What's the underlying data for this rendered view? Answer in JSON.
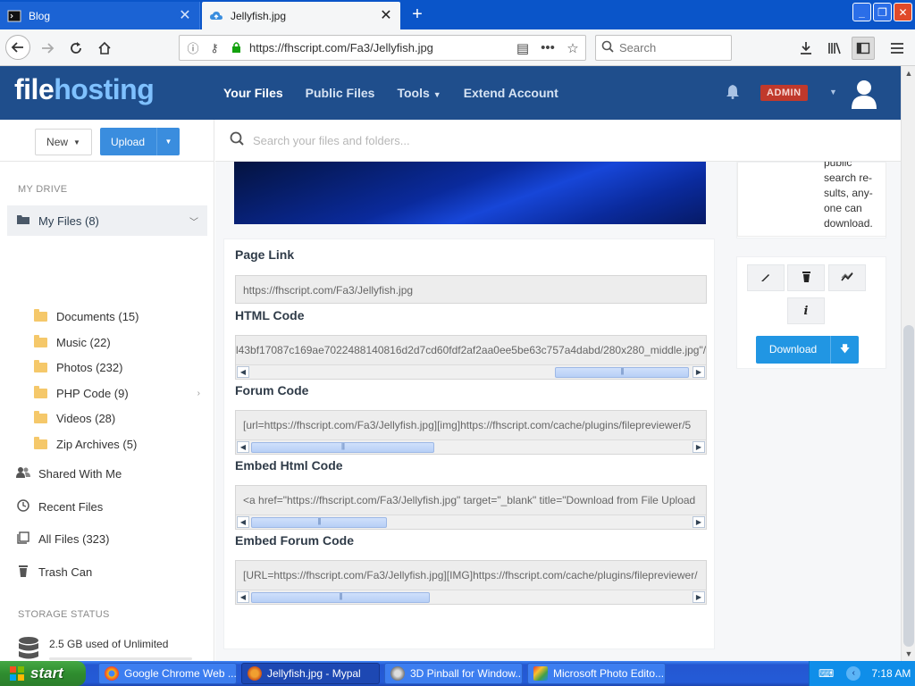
{
  "browser": {
    "tabs": [
      {
        "title": "Blog",
        "active": false,
        "icon": "terminal-icon"
      },
      {
        "title": "Jellyfish.jpg",
        "active": true,
        "icon": "cloud-upload-icon"
      }
    ],
    "url": "https://fhscript.com/Fa3/Jellyfish.jpg",
    "search_placeholder": "Search",
    "accent_color": "#0a55c9"
  },
  "site": {
    "logo_part1": "file",
    "logo_part2": "hosting",
    "nav": [
      {
        "label": "Your Files",
        "active": true
      },
      {
        "label": "Public Files",
        "active": false
      },
      {
        "label": "Tools",
        "active": false,
        "dropdown": true
      },
      {
        "label": "Extend Account",
        "active": false
      }
    ],
    "admin_badge": "ADMIN",
    "header_color": "#1f4e8c"
  },
  "toolbar": {
    "new_label": "New",
    "upload_label": "Upload",
    "files_search_placeholder": "Search your files and folders..."
  },
  "sidebar": {
    "my_drive_title": "MY DRIVE",
    "my_files": "My Files (8)",
    "folders": [
      {
        "label": "Documents (15)",
        "has_children": false
      },
      {
        "label": "Music (22)",
        "has_children": false
      },
      {
        "label": "Photos (232)",
        "has_children": false
      },
      {
        "label": "PHP Code (9)",
        "has_children": true
      },
      {
        "label": "Videos (28)",
        "has_children": false
      },
      {
        "label": "Zip Archives (5)",
        "has_children": false
      }
    ],
    "links": [
      {
        "label": "Shared With Me",
        "icon": "users-icon"
      },
      {
        "label": "Recent Files",
        "icon": "clock-icon"
      },
      {
        "label": "All Files (323)",
        "icon": "layers-icon"
      },
      {
        "label": "Trash Can",
        "icon": "trash-icon"
      }
    ],
    "storage_title": "STORAGE STATUS",
    "storage_text": "2.5 GB used of Unlimited",
    "storage_used_fraction": 0
  },
  "file": {
    "info_text": "public search re-sults, any-one can download.",
    "codes": [
      {
        "label": "Page Link",
        "value": "https://fhscript.com/Fa3/Jellyfish.jpg",
        "scroll": false
      },
      {
        "label": "HTML Code",
        "value": "l43bf17087c169ae7022488140816d2d7cd60fdf2af2aa0ee5be63c757a4dabd/280x280_middle.jpg\"/></a>",
        "scroll": true
      },
      {
        "label": "Forum Code",
        "value": "[url=https://fhscript.com/Fa3/Jellyfish.jpg][img]https://fhscript.com/cache/plugins/filepreviewer/5",
        "scroll": true
      },
      {
        "label": "Embed Html Code",
        "value": "<a href=\"https://fhscript.com/Fa3/Jellyfish.jpg\" target=\"_blank\" title=\"Download from File Upload",
        "scroll": true
      },
      {
        "label": "Embed Forum Code",
        "value": "[URL=https://fhscript.com/Fa3/Jellyfish.jpg][IMG]https://fhscript.com/cache/plugins/filepreviewer/",
        "scroll": true
      }
    ],
    "actions": [
      {
        "icon": "pencil-icon"
      },
      {
        "icon": "trash-icon"
      },
      {
        "icon": "stats-icon"
      },
      {
        "icon": "info-icon"
      }
    ],
    "download_label": "Download"
  },
  "taskbar": {
    "start_label": "start",
    "tasks": [
      {
        "label": "Google Chrome Web ...",
        "active": false
      },
      {
        "label": "Jellyfish.jpg - Mypal",
        "active": true
      },
      {
        "label": "3D Pinball for Window...",
        "active": false
      },
      {
        "label": "Microsoft Photo Edito...",
        "active": false
      }
    ],
    "clock": "7:18 AM"
  }
}
